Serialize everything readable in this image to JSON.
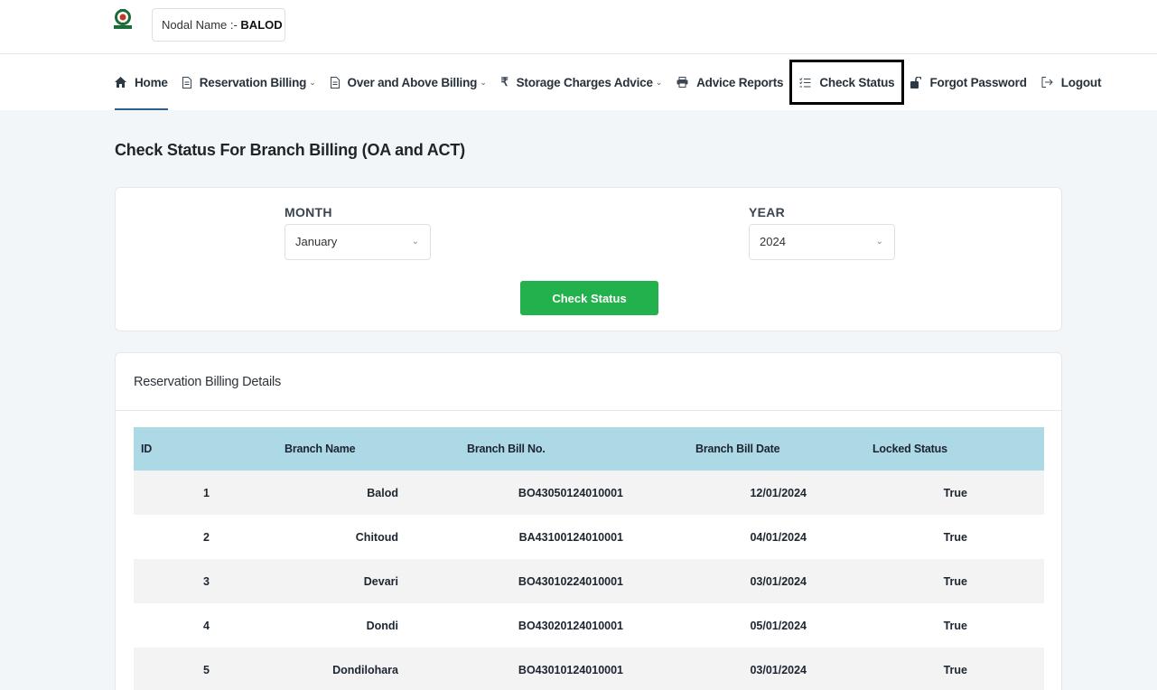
{
  "header": {
    "nodal_label": "Nodal Name :- ",
    "nodal_value": "BALOD"
  },
  "nav": {
    "items": [
      {
        "label": "Home",
        "icon": "home-icon",
        "dropdown": false,
        "active": true
      },
      {
        "label": "Reservation Billing",
        "icon": "document-icon",
        "dropdown": true
      },
      {
        "label": "Over and Above Billing",
        "icon": "document-icon",
        "dropdown": true
      },
      {
        "label": "Storage Charges Advice",
        "icon": "rupee-icon",
        "dropdown": true
      },
      {
        "label": "Advice Reports",
        "icon": "printer-icon",
        "dropdown": false
      },
      {
        "label": "Check Status",
        "icon": "list-check-icon",
        "dropdown": false,
        "highlighted": true
      },
      {
        "label": "Forgot Password",
        "icon": "unlock-icon",
        "dropdown": false
      },
      {
        "label": "Logout",
        "icon": "logout-icon",
        "dropdown": false
      }
    ]
  },
  "page": {
    "title": "Check Status For Branch Billing (OA and ACT)"
  },
  "filters": {
    "month_label": "MONTH",
    "month_value": "January",
    "year_label": "YEAR",
    "year_value": "2024",
    "check_button": "Check Status"
  },
  "details": {
    "title": "Reservation Billing Details",
    "columns": [
      "ID",
      "Branch Name",
      "Branch Bill No.",
      "Branch Bill Date",
      "Locked Status"
    ],
    "rows": [
      [
        "1",
        "Balod",
        "BO43050124010001",
        "12/01/2024",
        "True"
      ],
      [
        "2",
        "Chitoud",
        "BA43100124010001",
        "04/01/2024",
        "True"
      ],
      [
        "3",
        "Devari",
        "BO43010224010001",
        "03/01/2024",
        "True"
      ],
      [
        "4",
        "Dondi",
        "BO43020124010001",
        "05/01/2024",
        "True"
      ],
      [
        "5",
        "Dondilohara",
        "BO43010124010001",
        "03/01/2024",
        "True"
      ]
    ]
  },
  "colors": {
    "accent_green": "#22b14c",
    "table_header": "#add8e6",
    "active_underline": "#2d5f8d"
  }
}
